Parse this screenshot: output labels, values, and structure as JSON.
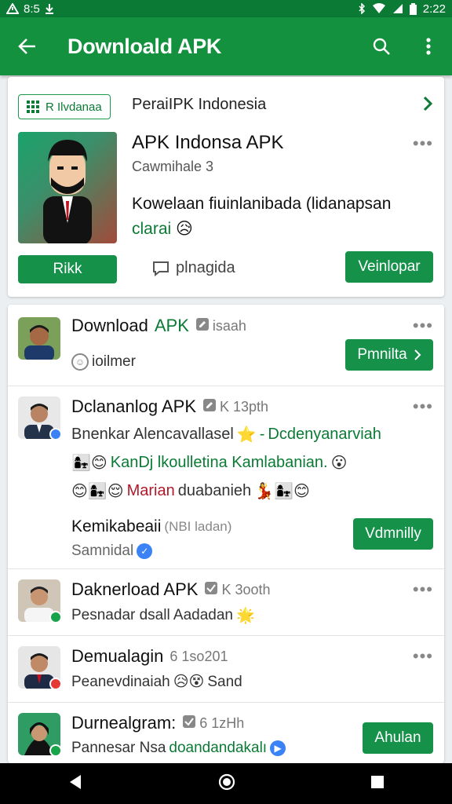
{
  "status_bar": {
    "time_left": "8:5",
    "time_right": "2:22"
  },
  "app_bar": {
    "title": "Downloald APK"
  },
  "featured": {
    "tag_label": "R Ilvdanaa",
    "top_label": "PeraiIPK Indonesia",
    "app_name": "APK Indonsa APK",
    "subtitle": "Cawmihale 3",
    "description_black": "Kowelaan fiuinlanibada (lidanapsan",
    "description_green": "clarai",
    "left_button": "Rikk",
    "chat_label": "plnagida",
    "download_button": "Veinlopar"
  },
  "feed": [
    {
      "name_black": "Download",
      "name_green": "APK",
      "meta": "isaah",
      "line1": "ioilmer",
      "button": "Pmnilta"
    },
    {
      "name": "Dclananlog APK",
      "meta": "K 13pth",
      "line1_black": "Bnenkar Alencavallasel",
      "line1_green": "Dcdenyanarviah",
      "line2_green": "KanDj lkoulletina Kamlabanian.",
      "line3_red": "Marian",
      "line3_black": "duabanieh",
      "line4": "Kemikabeaii",
      "line4_meta": "(NBI ladan)",
      "line5": "Samnidal",
      "button": "Vdmnilly"
    },
    {
      "name": "Daknerload APK",
      "meta": "K 3ooth",
      "line1": "Pesnadar dsall Aadadan"
    },
    {
      "name": "Demualagin",
      "meta": "6 1so201",
      "line1": "Peanevdinaiah",
      "line1_tail": "Sand"
    },
    {
      "name": "Durnealgram:",
      "meta": "6 1zHh",
      "line1_black": "Pannesar Nsa",
      "line1_green": "doandandakalı",
      "button": "Ahulan"
    }
  ],
  "colors": {
    "primary": "#14913f",
    "dark": "#0b7a35",
    "accent_red": "#b0192a"
  }
}
